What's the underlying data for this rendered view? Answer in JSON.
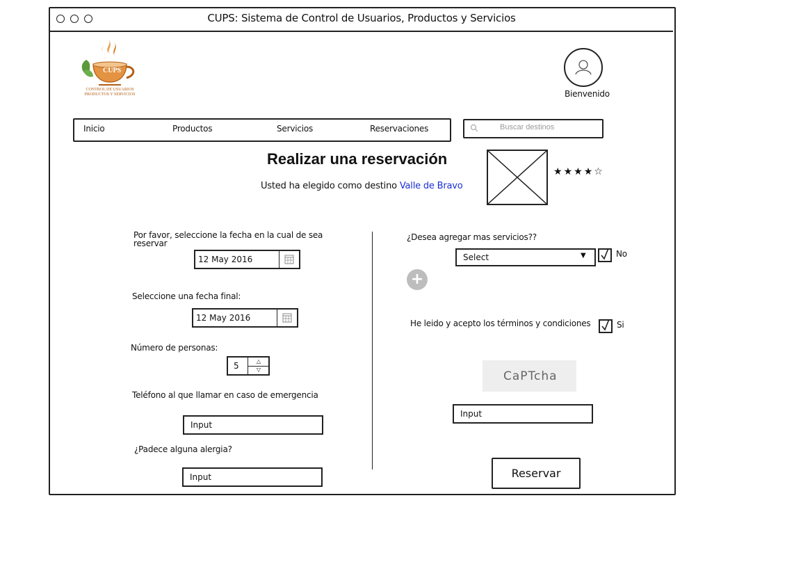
{
  "window": {
    "title": "CUPS: Sistema de Control de Usuarios, Productos y Servicios"
  },
  "logo": {
    "name": "CUPS",
    "tagline": "CONTROL DE USUARIOS PRODUCTOS Y SERVICIOS"
  },
  "user": {
    "greeting": "Bienvenido"
  },
  "nav": {
    "items": [
      "Inicio",
      "Productos",
      "Servicios",
      "Reservaciones"
    ]
  },
  "search": {
    "placeholder": "Buscar destinos"
  },
  "main": {
    "title": "Realizar una reservación",
    "destination_prefix": "Usted ha elegido como destino",
    "destination": "Valle de Bravo",
    "rating": {
      "value": 4,
      "max": 5
    }
  },
  "form": {
    "start_date_label": "Por favor, seleccione la fecha en la cual de sea reservar",
    "start_date_value": "12 May 2016",
    "end_date_label": "Seleccione una fecha final:",
    "end_date_value": "12 May 2016",
    "people_label": "Número de personas:",
    "people_value": "5",
    "phone_label": "Teléfono al que llamar en caso de emergencia",
    "phone_value": "Input",
    "allergy_label": "¿Padece alguna alergia?",
    "allergy_value": "Input",
    "services_label": "¿Desea agregar mas servicios??",
    "services_select": "Select",
    "services_check_label": "No",
    "terms_label": "He leido y acepto los términos y condiciones",
    "terms_check_label": "Si",
    "captcha_text": "CaPTcha",
    "captcha_input": "Input",
    "submit_label": "Reservar"
  }
}
